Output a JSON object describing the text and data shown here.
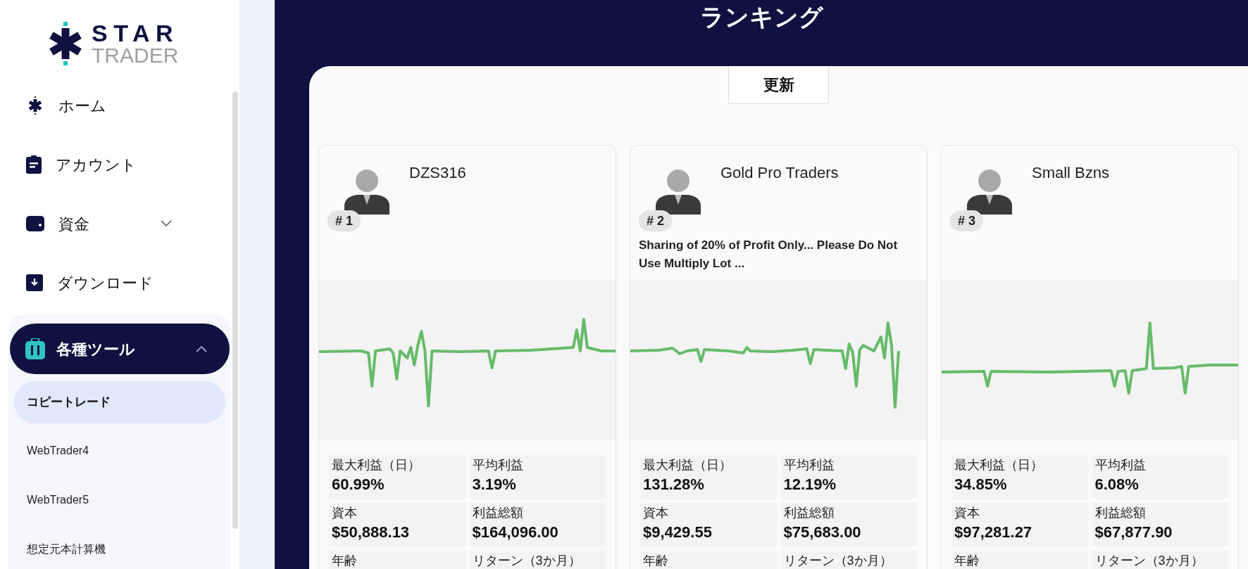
{
  "logo": {
    "line_1": "STAR",
    "line_2": "TRADER"
  },
  "sidebar": {
    "items": [
      {
        "label": "ホーム",
        "selected": false
      },
      {
        "label": "アカウント",
        "selected": false
      },
      {
        "label": "資金",
        "selected": false,
        "expanded": false
      },
      {
        "label": "ダウンロード",
        "selected": false
      },
      {
        "label": "各種ツール",
        "selected": true,
        "expanded": true,
        "children": [
          {
            "label": "コピートレード",
            "selected": true
          },
          {
            "label": "WebTrader4",
            "selected": false
          },
          {
            "label": "WebTrader5",
            "selected": false
          },
          {
            "label": "想定元本計算機",
            "selected": false
          }
        ]
      }
    ]
  },
  "main": {
    "title": "ランキング",
    "refresh_button": "更新",
    "traders": [
      {
        "rank": "# 1",
        "name": "DZS316",
        "stats": [
          {
            "label": "最大利益（日）",
            "value": "60.99%"
          },
          {
            "label": "平均利益",
            "value": "3.19%"
          },
          {
            "label": "資本",
            "value": "$50,888.13"
          },
          {
            "label": "利益総額",
            "value": "$164,096.00"
          },
          {
            "label": "年齢"
          },
          {
            "label": "リターン（3か月）"
          }
        ]
      },
      {
        "rank": "# 2",
        "name": "Gold Pro Traders",
        "description": "Sharing of 20% of Profit Only... Please Do Not Use Multiply Lot ...",
        "stats": [
          {
            "label": "最大利益（日）",
            "value": "131.28%"
          },
          {
            "label": "平均利益",
            "value": "12.19%"
          },
          {
            "label": "資本",
            "value": "$9,429.55"
          },
          {
            "label": "利益総額",
            "value": "$75,683.00"
          },
          {
            "label": "年齢"
          },
          {
            "label": "リターン（3か月）"
          }
        ]
      },
      {
        "rank": "# 3",
        "name": "Small Bzns",
        "stats": [
          {
            "label": "最大利益（日）",
            "value": "34.85%"
          },
          {
            "label": "平均利益",
            "value": "6.08%"
          },
          {
            "label": "資本",
            "value": "$97,281.27"
          },
          {
            "label": "利益総額",
            "value": "$67,877.90"
          },
          {
            "label": "年齢"
          },
          {
            "label": "リターン（3か月）"
          }
        ]
      }
    ]
  }
}
